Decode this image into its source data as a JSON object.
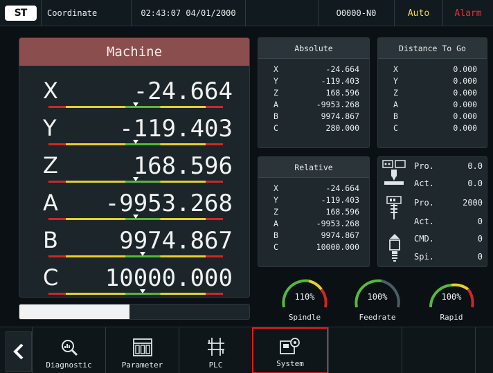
{
  "topbar": {
    "logo_text": "ST",
    "title": "Coordinate",
    "datetime": "02:43:07 04/01/2000",
    "program": "O0000-N0",
    "mode": "Auto",
    "alarm": "Alarm"
  },
  "machine": {
    "title": "Machine",
    "axes": [
      {
        "name": "X",
        "value": "-24.664",
        "pointer": 0.5
      },
      {
        "name": "Y",
        "value": "-119.403",
        "pointer": 0.5
      },
      {
        "name": "Z",
        "value": "168.596",
        "pointer": 0.5
      },
      {
        "name": "A",
        "value": "-9953.268",
        "pointer": 0.5
      },
      {
        "name": "B",
        "value": "9974.867",
        "pointer": 0.54
      },
      {
        "name": "C",
        "value": "10000.000",
        "pointer": 0.54
      }
    ],
    "progress": 0.48
  },
  "absolute": {
    "title": "Absolute",
    "rows": [
      {
        "axis": "X",
        "value": "-24.664"
      },
      {
        "axis": "Y",
        "value": "-119.403"
      },
      {
        "axis": "Z",
        "value": "168.596"
      },
      {
        "axis": "A",
        "value": "-9953.268"
      },
      {
        "axis": "B",
        "value": "9974.867"
      },
      {
        "axis": "C",
        "value": "280.000"
      }
    ]
  },
  "distance": {
    "title": "Distance To Go",
    "rows": [
      {
        "axis": "X",
        "value": "0.000"
      },
      {
        "axis": "Y",
        "value": "0.000"
      },
      {
        "axis": "Z",
        "value": "0.000"
      },
      {
        "axis": "A",
        "value": "0.000"
      },
      {
        "axis": "B",
        "value": "0.000"
      },
      {
        "axis": "C",
        "value": "0.000"
      }
    ]
  },
  "relative": {
    "title": "Relative",
    "rows": [
      {
        "axis": "X",
        "value": "-24.664"
      },
      {
        "axis": "Y",
        "value": "-119.403"
      },
      {
        "axis": "Z",
        "value": "168.596"
      },
      {
        "axis": "A",
        "value": "-9953.268"
      },
      {
        "axis": "B",
        "value": "9974.867"
      },
      {
        "axis": "C",
        "value": "10000.000"
      }
    ]
  },
  "info": {
    "feed_pro_label": "Pro.",
    "feed_pro": "0.0",
    "feed_act_label": "Act.",
    "feed_act": "0.0",
    "spindle_pro_label": "Pro.",
    "spindle_pro": "2000",
    "spindle_act_label": "Act.",
    "spindle_act": "0",
    "cmd_label": "CMD.",
    "cmd": "0",
    "spi_label": "Spi.",
    "spi": "0",
    "icons": [
      "feed-rate-icon",
      "spindle-tool-icon",
      "spindle-motor-icon"
    ]
  },
  "gauges": [
    {
      "name": "Spindle",
      "value": "110%",
      "level": 1.1
    },
    {
      "name": "Feedrate",
      "value": "100%",
      "level": 1.0
    },
    {
      "name": "Rapid",
      "value": "100%",
      "level": 1.0
    }
  ],
  "softkeys": [
    {
      "label": "Diagnostic",
      "icon": "diagnostic-icon"
    },
    {
      "label": "Parameter",
      "icon": "parameter-icon"
    },
    {
      "label": "PLC",
      "icon": "plc-ladder-icon"
    },
    {
      "label": "System",
      "icon": "system-icon",
      "active": true
    }
  ],
  "colors": {
    "machine_header": "#8b4e4e",
    "mode": "#f5d63a",
    "alarm": "#e63030",
    "gauge_green": "#56b83c",
    "gauge_yellow": "#e7cf2c",
    "gauge_red": "#d02626",
    "active_border": "#e01c1c"
  }
}
